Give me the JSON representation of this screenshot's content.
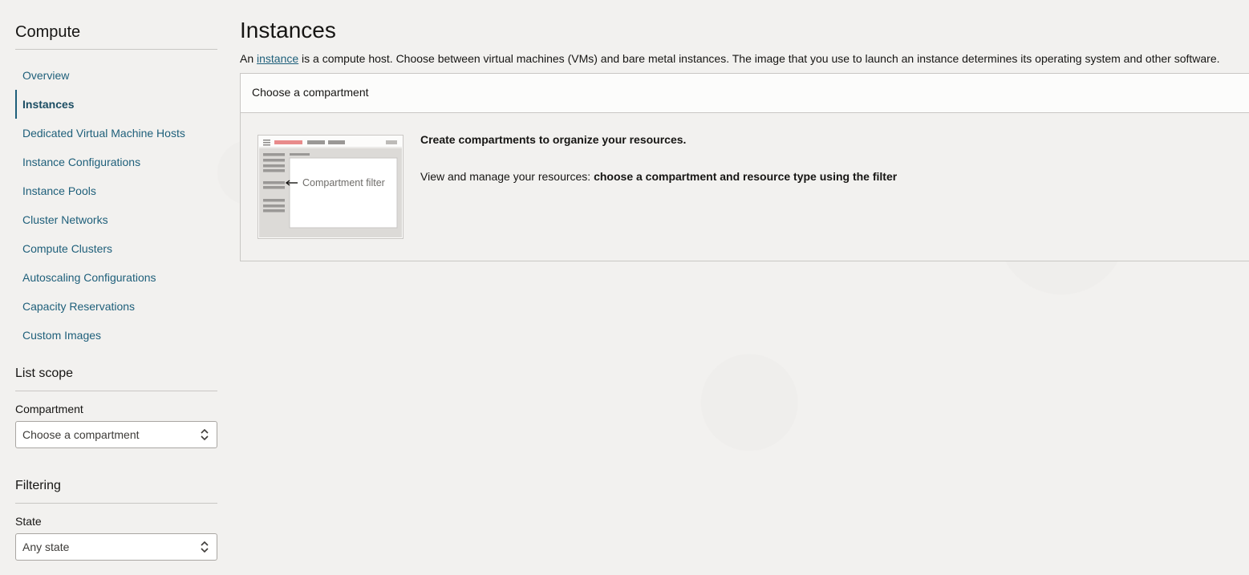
{
  "sidebar": {
    "title": "Compute",
    "items": [
      {
        "label": "Overview"
      },
      {
        "label": "Instances"
      },
      {
        "label": "Dedicated Virtual Machine Hosts"
      },
      {
        "label": "Instance Configurations"
      },
      {
        "label": "Instance Pools"
      },
      {
        "label": "Cluster Networks"
      },
      {
        "label": "Compute Clusters"
      },
      {
        "label": "Autoscaling Configurations"
      },
      {
        "label": "Capacity Reservations"
      },
      {
        "label": "Custom Images"
      }
    ],
    "active_item": "Instances",
    "list_scope": {
      "title": "List scope",
      "compartment_label": "Compartment",
      "compartment_value": "Choose a compartment"
    },
    "filtering": {
      "title": "Filtering",
      "state_label": "State",
      "state_value": "Any state"
    }
  },
  "main": {
    "title": "Instances",
    "desc_prefix": "An ",
    "desc_link": "instance",
    "desc_suffix": " is a compute host. Choose between virtual machines (VMs) and bare metal instances. The image that you use to launch an instance determines its operating system and other software.",
    "panel": {
      "header": "Choose a compartment",
      "illustration_label": "Compartment filter",
      "heading": "Create compartments to organize your resources.",
      "line_prefix": "View and manage your resources: ",
      "line_strong": "choose a compartment and resource type using the filter"
    }
  },
  "colors": {
    "link": "#1e5f7a",
    "background": "#f2f1ef",
    "illustration_accent": "#e88b8b"
  }
}
